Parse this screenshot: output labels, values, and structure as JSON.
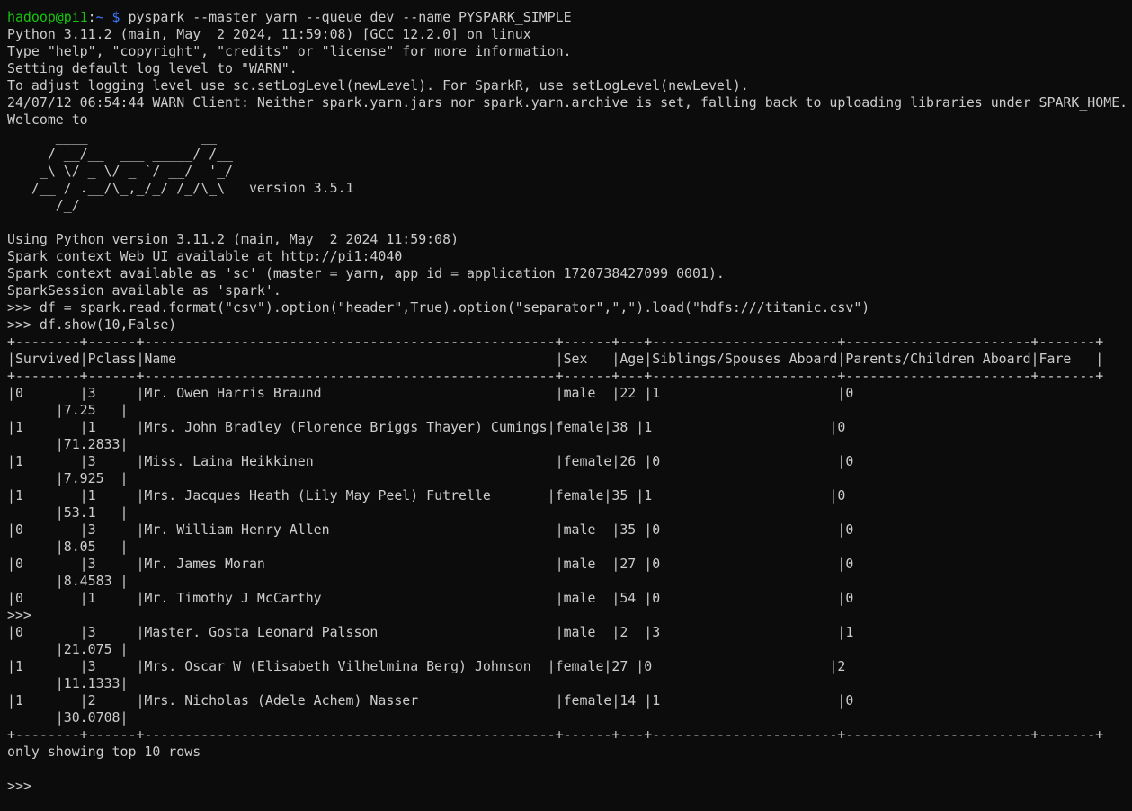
{
  "terminal": {
    "prompt": {
      "user_host": "hadoop@pi1",
      "colon": ":",
      "path": "~",
      "dollar": " $",
      "command": " pyspark --master yarn --queue dev --name PYSPARK_SIMPLE"
    },
    "lines": [
      "",
      "Python 3.11.2 (main, May  2 2024, 11:59:08) [GCC 12.2.0] on linux",
      "Type \"help\", \"copyright\", \"credits\" or \"license\" for more information.",
      "Setting default log level to \"WARN\".",
      "To adjust logging level use sc.setLogLevel(newLevel). For SparkR, use setLogLevel(newLevel).",
      "24/07/12 06:54:44 WARN Client: Neither spark.yarn.jars nor spark.yarn.archive is set, falling back to uploading libraries under SPARK_HOME.",
      "Welcome to",
      "      ____              __",
      "     / __/__  ___ _____/ /__",
      "    _\\ \\/ _ \\/ _ `/ __/  '_/",
      "   /__ / .__/\\_,_/_/ /_/\\_\\   version 3.5.1",
      "      /_/",
      "",
      "Using Python version 3.11.2 (main, May  2 2024 11:59:08)",
      "Spark context Web UI available at http://pi1:4040",
      "Spark context available as 'sc' (master = yarn, app id = application_1720738427099_0001).",
      "SparkSession available as 'spark'.",
      ">>> df = spark.read.format(\"csv\").option(\"header\",True).option(\"separator\",\",\").load(\"hdfs:///titanic.csv\")",
      ">>> df.show(10,False)",
      "+--------+------+---------------------------------------------------+------+---+-----------------------+-----------------------+-------+",
      "|Survived|Pclass|Name                                               |Sex   |Age|Siblings/Spouses Aboard|Parents/Children Aboard|Fare   |",
      "+--------+------+---------------------------------------------------+------+---+-----------------------+-----------------------+-------+",
      "|0       |3     |Mr. Owen Harris Braund                             |male  |22 |1                      |0",
      "      |7.25   |",
      "|1       |1     |Mrs. John Bradley (Florence Briggs Thayer) Cumings|female|38 |1                      |0",
      "      |71.2833|",
      "|1       |3     |Miss. Laina Heikkinen                              |female|26 |0                      |0",
      "      |7.925  |",
      "|1       |1     |Mrs. Jacques Heath (Lily May Peel) Futrelle       |female|35 |1                      |0",
      "      |53.1   |",
      "|0       |3     |Mr. William Henry Allen                            |male  |35 |0                      |0",
      "      |8.05   |",
      "|0       |3     |Mr. James Moran                                    |male  |27 |0                      |0",
      "      |8.4583 |",
      "|0       |1     |Mr. Timothy J McCarthy                             |male  |54 |0                      |0",
      ">>>",
      "|0       |3     |Master. Gosta Leonard Palsson                      |male  |2  |3                      |1",
      "      |21.075 |",
      "|1       |3     |Mrs. Oscar W (Elisabeth Vilhelmina Berg) Johnson  |female|27 |0                      |2",
      "      |11.1333|",
      "|1       |2     |Mrs. Nicholas (Adele Achem) Nasser                 |female|14 |1                      |0",
      "      |30.0708|",
      "+--------+------+---------------------------------------------------+------+---+-----------------------+-----------------------+-------+",
      "only showing top 10 rows",
      "",
      ">>>"
    ]
  },
  "colors": {
    "background": "#0c0c0c",
    "text": "#cccccc",
    "prompt_user": "#16c60c",
    "prompt_path": "#3b78ff"
  }
}
